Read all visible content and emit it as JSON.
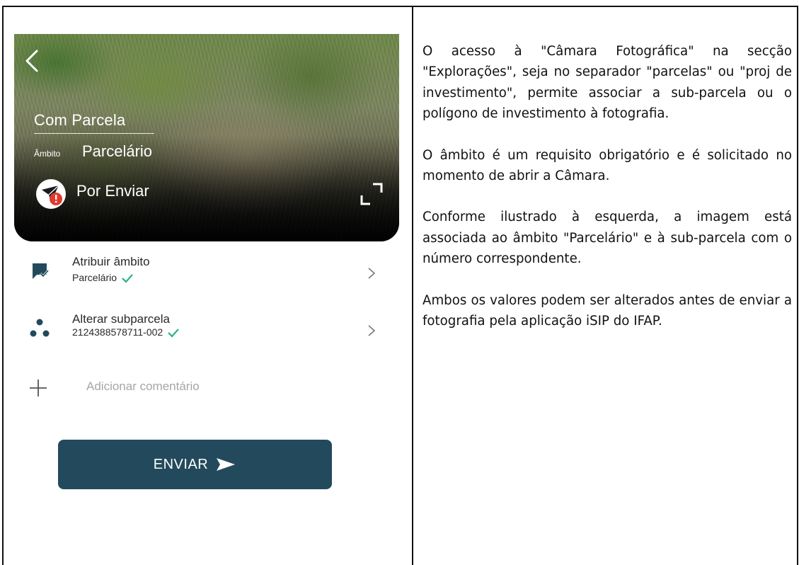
{
  "phone": {
    "photo": {
      "title": "Com Parcela",
      "scope_label": "Âmbito",
      "scope_value": "Parcelário",
      "status": "Por Enviar"
    },
    "rows": [
      {
        "title": "Atribuir âmbito",
        "subtitle": "Parcelário",
        "icon": "chat-check-icon"
      },
      {
        "title": "Alterar subparcela",
        "subtitle": "2124388578711-002",
        "icon": "three-dots-icon"
      }
    ],
    "comment_placeholder": "Adicionar comentário",
    "send_label": "ENVIAR",
    "colors": {
      "accent": "#234a5c",
      "check": "#2bb08a",
      "status_badge": "#e03a2f",
      "row_icon": "#234a5c"
    }
  },
  "description": {
    "paragraphs": [
      "O acesso à \"Câmara Fotográfica\" na secção \"Explorações\", seja no separador \"parcelas\" ou \"proj de investimento\", permite associar a sub-parcela ou o polígono de investimento à fotografia.",
      "O âmbito é um requisito obrigatório e é solicitado no momento de abrir a Câmara.",
      "Conforme ilustrado à esquerda, a imagem está associada ao âmbito \"Parcelário\" e à sub-parcela com o número correspondente.",
      "Ambos os valores podem ser alterados antes de enviar a fotografia pela aplicação iSIP do IFAP."
    ]
  }
}
